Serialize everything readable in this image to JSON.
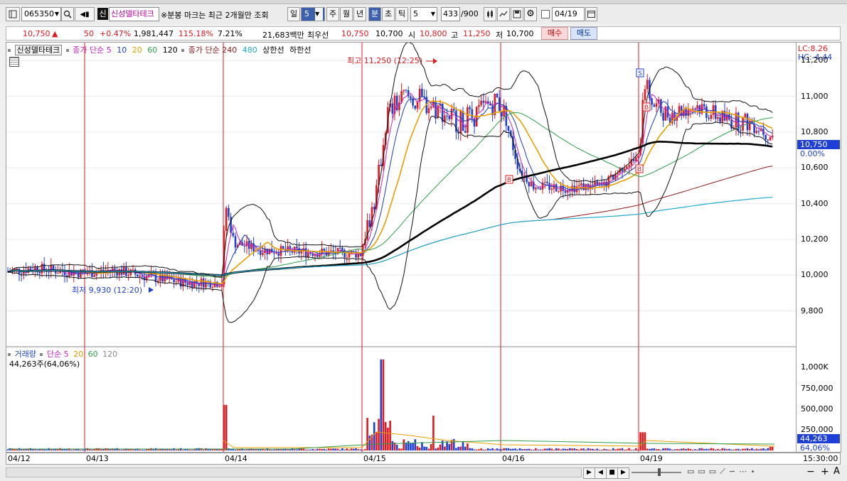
{
  "toolbar": {
    "code": "065350",
    "credit_badge": "신",
    "name": "신성델타테크",
    "notice": "※분봉 마크는 최근 2개월만 조회",
    "period_buttons": [
      "일",
      "5",
      "주",
      "월",
      "년",
      "분",
      "초",
      "틱"
    ],
    "interval_value": "5",
    "count": "433",
    "count_total": "/900",
    "date": "04/19"
  },
  "quote": {
    "price": "10,750",
    "arrow": "▲",
    "change": "50",
    "change_pct": "+0.47%",
    "volume": "1,981,447",
    "vol_ratio": "115.18%",
    "turnover": "7.21%",
    "amount": "21,683백만",
    "priority_label": "최우선",
    "ask": "10,750",
    "bid": "10,700",
    "open_label": "시",
    "open": "10,800",
    "high_label": "고",
    "high": "11,250",
    "low_label": "저",
    "low": "10,700",
    "buy_label": "매수",
    "sell_label": "매도"
  },
  "legend": {
    "stock": "신성델타테크",
    "ma_label": "종가 단순",
    "ma_periods": [
      "5",
      "10",
      "20",
      "60",
      "120"
    ],
    "ma2_label": "종가 단순",
    "ma2_periods": [
      "240",
      "480"
    ],
    "limit_up": "상한선",
    "limit_down": "하한선",
    "vol_title": "거래량",
    "vol_ma_label": "단순",
    "vol_ma_periods": [
      "5",
      "20",
      "60",
      "120"
    ],
    "vol_current": "44,263주(64,06%)"
  },
  "annotations": {
    "max_label": "최고 11,250 (12:25)",
    "min_label": "최저 9,930 (12:20)"
  },
  "axis": {
    "lc": "LC:8.26",
    "hc": "HC:-4.44",
    "price_ticks": [
      "11,200",
      "11,000",
      "10,800",
      "10,600",
      "10,400",
      "10,200",
      "10,000",
      "9,800"
    ],
    "current_price": "10,750",
    "current_pct": "0.00%",
    "vol_ticks": [
      "1,000K",
      "750,000",
      "500,000",
      "250,000"
    ],
    "vol_current": "44,263",
    "vol_pct": "64,06%",
    "time": "15:30:00"
  },
  "colors": {
    "up": "#e0191f",
    "down": "#1e3fd6",
    "ma5": "#c426c4",
    "ma10": "#1c3fb3",
    "ma20": "#e8a000",
    "ma60": "#2f9e4a",
    "ma120": "#000000",
    "ma240": "#8b1a1a",
    "ma480": "#22aacc"
  },
  "chart_data": {
    "type": "candlestick",
    "interval": "5min",
    "x": [
      "04/12",
      "04/13",
      "04/14",
      "04/15",
      "04/16",
      "04/19"
    ],
    "ylim": [
      9600,
      11300
    ],
    "series": [
      {
        "name": "종가 단순 5",
        "color": "#c426c4"
      },
      {
        "name": "종가 단순 10",
        "color": "#1c3fb3"
      },
      {
        "name": "종가 단순 20",
        "color": "#e8a000"
      },
      {
        "name": "종가 단순 60",
        "color": "#2f9e4a"
      },
      {
        "name": "종가 단순 120",
        "color": "#000000"
      },
      {
        "name": "종가 단순 240",
        "color": "#8b1a1a"
      },
      {
        "name": "종가 단순 480",
        "color": "#22aacc"
      }
    ],
    "day_close_approx": [
      {
        "day": "04/12",
        "close": 10030
      },
      {
        "day": "04/13",
        "close": 9980
      },
      {
        "day": "04/14",
        "close": 10120
      },
      {
        "day": "04/15",
        "close": 10950
      },
      {
        "day": "04/16",
        "close": 10480
      },
      {
        "day": "04/19",
        "close": 10750
      }
    ],
    "high": {
      "value": 11250,
      "time": "12:25"
    },
    "low": {
      "value": 9930,
      "time": "12:20"
    },
    "volume_ylim": [
      0,
      1150000
    ],
    "current_volume": 44263
  }
}
